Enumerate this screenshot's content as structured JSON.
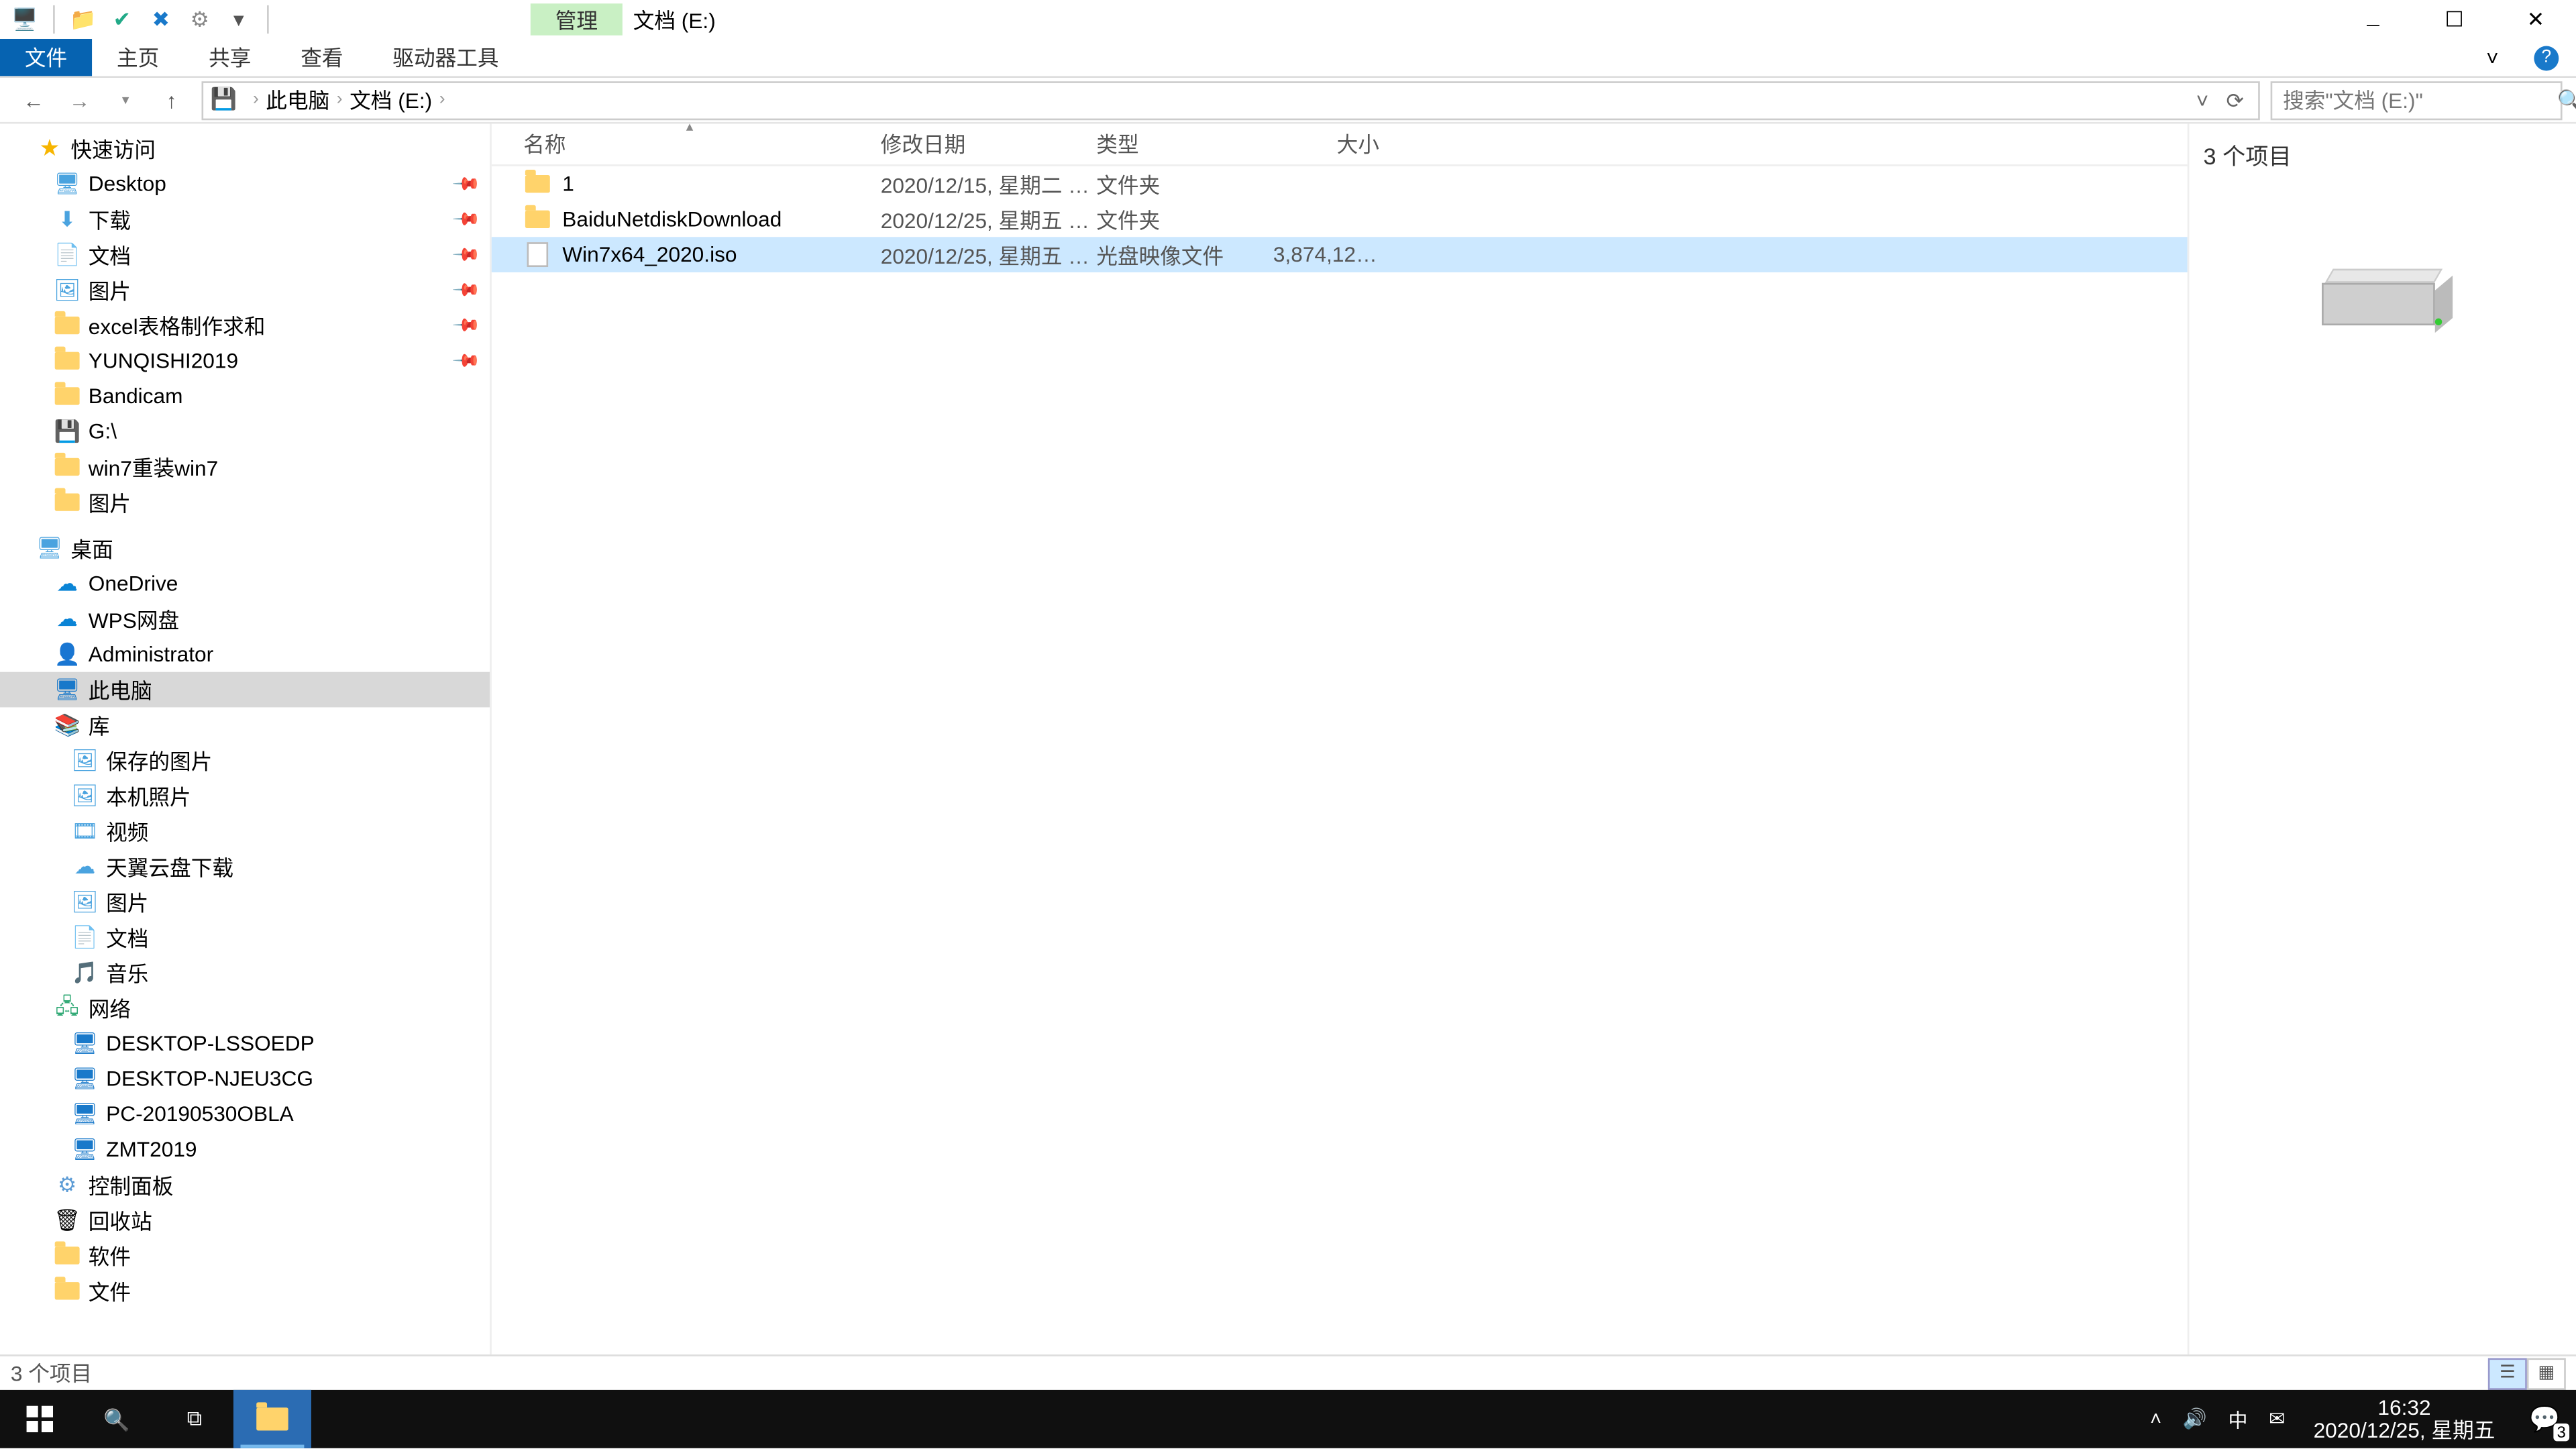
{
  "title": {
    "manage": "管理",
    "location": "文档 (E:)"
  },
  "ribbon": {
    "file": "文件",
    "home": "主页",
    "share": "共享",
    "view": "查看",
    "drive_tools": "驱动器工具"
  },
  "addr": {
    "root": "此电脑",
    "current": "文档 (E:)"
  },
  "search": {
    "placeholder": "搜索\"文档 (E:)\""
  },
  "cols": {
    "name": "名称",
    "date": "修改日期",
    "type": "类型",
    "size": "大小"
  },
  "files": [
    {
      "name": "1",
      "date": "2020/12/15, 星期二 1...",
      "type": "文件夹",
      "size": "",
      "icon": "folder"
    },
    {
      "name": "BaiduNetdiskDownload",
      "date": "2020/12/25, 星期五 1...",
      "type": "文件夹",
      "size": "",
      "icon": "folder"
    },
    {
      "name": "Win7x64_2020.iso",
      "date": "2020/12/25, 星期五 1...",
      "type": "光盘映像文件",
      "size": "3,874,126...",
      "icon": "file",
      "selected": true
    }
  ],
  "nav": {
    "quick": "快速访问",
    "quick_items": [
      "Desktop",
      "下载",
      "文档",
      "图片",
      "excel表格制作求和",
      "YUNQISHI2019",
      "Bandicam",
      "G:\\",
      "win7重装win7",
      "图片"
    ],
    "desktop": "桌面",
    "desktop_items": [
      "OneDrive",
      "WPS网盘",
      "Administrator",
      "此电脑",
      "库"
    ],
    "lib_items": [
      "保存的图片",
      "本机照片",
      "视频",
      "天翼云盘下载",
      "图片",
      "文档",
      "音乐"
    ],
    "network": "网络",
    "net_items": [
      "DESKTOP-LSSOEDP",
      "DESKTOP-NJEU3CG",
      "PC-20190530OBLA",
      "ZMT2019"
    ],
    "control": "控制面板",
    "recycle": "回收站",
    "soft": "软件",
    "docs": "文件"
  },
  "preview": {
    "count": "3 个项目"
  },
  "status": {
    "text": "3 个项目"
  },
  "tray": {
    "ime": "中",
    "time": "16:32",
    "date": "2020/12/25, 星期五",
    "notif": "3"
  }
}
